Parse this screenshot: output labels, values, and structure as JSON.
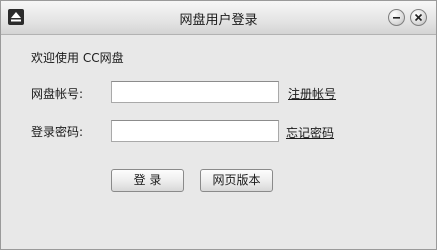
{
  "window": {
    "title": "网盘用户登录",
    "app_icon": "eject-icon",
    "controls": {
      "minimize_icon": "minus-icon",
      "close_icon": "close-icon"
    }
  },
  "form": {
    "welcome_text": "欢迎使用 CC网盘",
    "account_label": "网盘帐号:",
    "account_value": "",
    "password_label": "登录密码:",
    "password_value": "",
    "register_link": "注册帐号",
    "forgot_link": "忘记密码",
    "login_button": "登 录",
    "web_button": "网页版本"
  }
}
